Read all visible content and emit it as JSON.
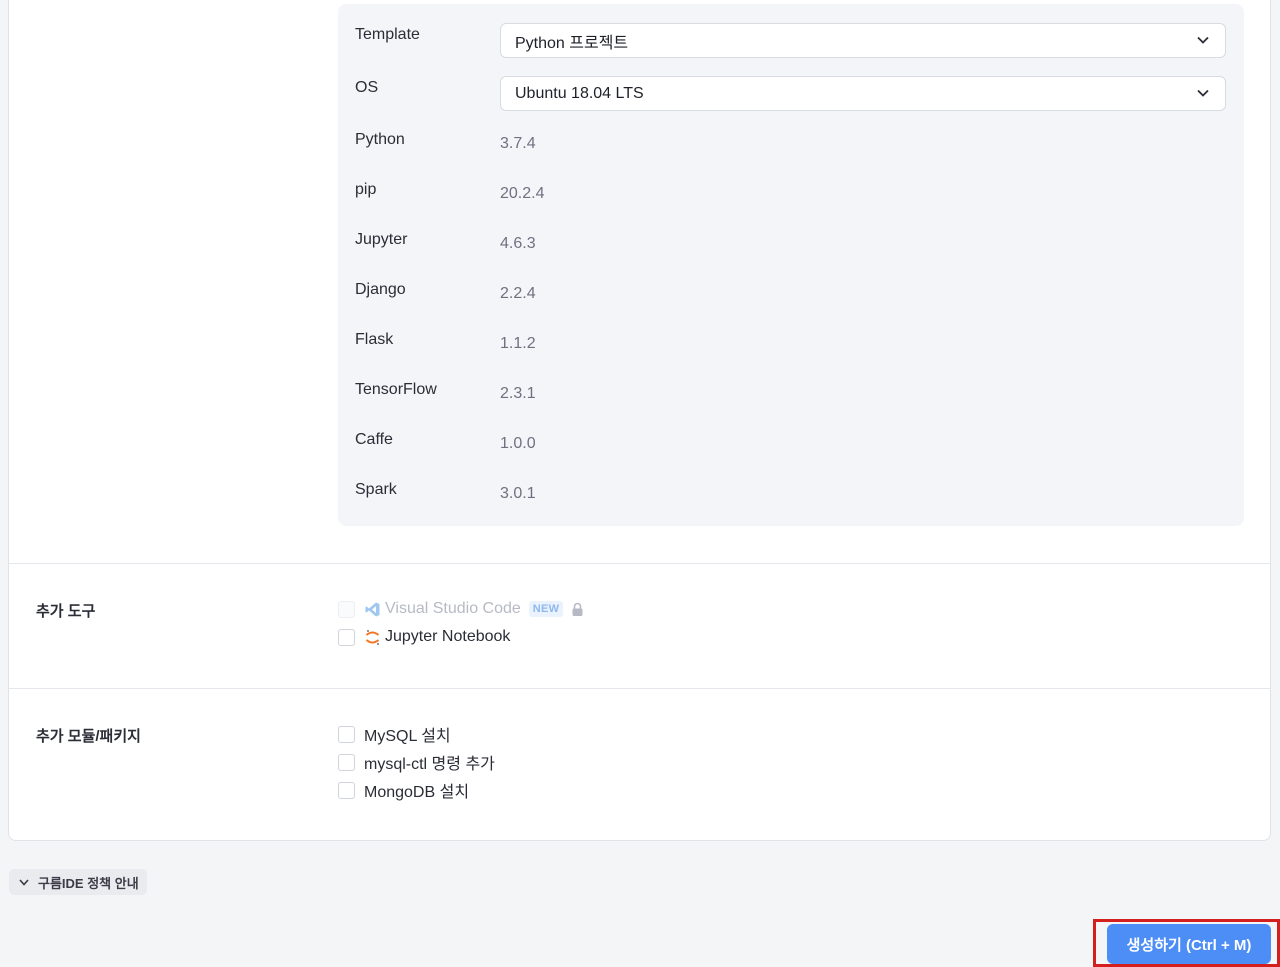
{
  "software_stack": {
    "template": {
      "label": "Template",
      "value": "Python 프로젝트"
    },
    "os": {
      "label": "OS",
      "value": "Ubuntu 18.04 LTS"
    },
    "versions": [
      {
        "label": "Python",
        "value": "3.7.4"
      },
      {
        "label": "pip",
        "value": "20.2.4"
      },
      {
        "label": "Jupyter",
        "value": "4.6.3"
      },
      {
        "label": "Django",
        "value": "2.2.4"
      },
      {
        "label": "Flask",
        "value": "1.1.2"
      },
      {
        "label": "TensorFlow",
        "value": "2.3.1"
      },
      {
        "label": "Caffe",
        "value": "1.0.0"
      },
      {
        "label": "Spark",
        "value": "3.0.1"
      }
    ]
  },
  "extra_tools": {
    "title": "추가 도구",
    "items": [
      {
        "label": "Visual Studio Code",
        "badge": "NEW",
        "icon": "vscode-icon",
        "disabled": true,
        "locked": true
      },
      {
        "label": "Jupyter Notebook",
        "icon": "jupyter-icon",
        "disabled": false
      }
    ]
  },
  "extra_modules": {
    "title": "추가 모듈/패키지",
    "items": [
      {
        "label": "MySQL 설치"
      },
      {
        "label": "mysql-ctl 명령 추가"
      },
      {
        "label": "MongoDB 설치"
      }
    ]
  },
  "policy": {
    "label": "구름IDE 정책 안내"
  },
  "create_button": {
    "label": "생성하기 (Ctrl + M)"
  },
  "colors": {
    "primary": "#4c8df6",
    "highlight_border": "#d41f1f",
    "jupyter": "#f37726",
    "vscode": "#9fc7f0"
  }
}
